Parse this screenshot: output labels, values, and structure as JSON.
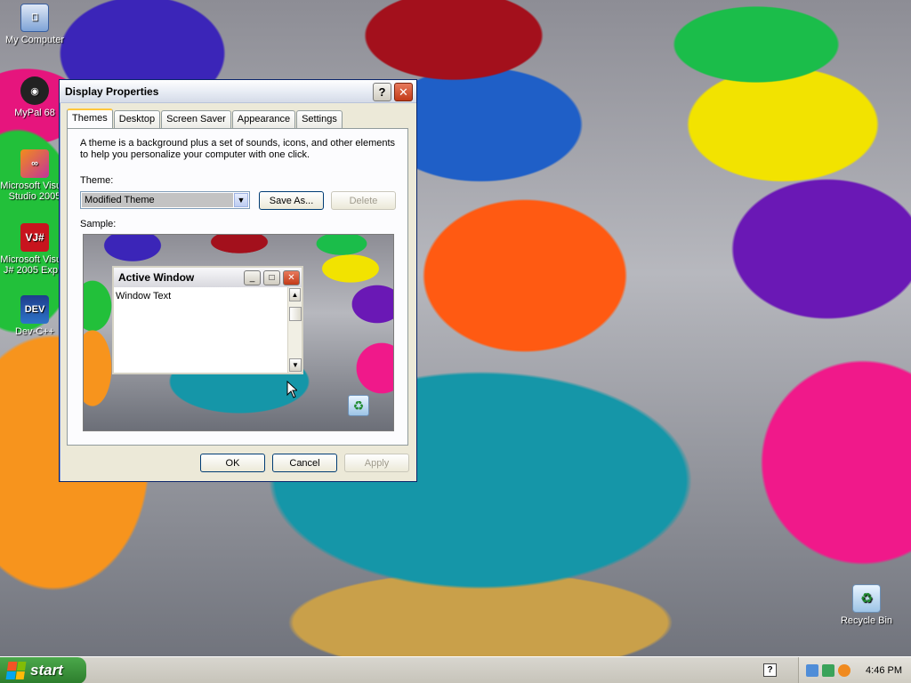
{
  "desktop_icons": [
    {
      "label": "My Computer",
      "icon": "my-computer-icon"
    },
    {
      "label": "MyPal 68",
      "icon": "mypal-icon"
    },
    {
      "label": "Microsoft Visual Studio 2005",
      "icon": "visual-studio-icon"
    },
    {
      "label": "Microsoft Visual J# 2005 Exp...",
      "icon": "vjsharp-icon"
    },
    {
      "label": "Dev-C++",
      "icon": "dev-cpp-icon"
    },
    {
      "label": "Recycle Bin",
      "icon": "recycle-bin-icon"
    }
  ],
  "window": {
    "title": "Display Properties",
    "tabs": [
      "Themes",
      "Desktop",
      "Screen Saver",
      "Appearance",
      "Settings"
    ],
    "active_tab": "Themes",
    "description": "A theme is a background plus a set of sounds, icons, and other elements to help you personalize your computer with one click.",
    "theme_label": "Theme:",
    "theme_value": "Modified Theme",
    "save_as_label": "Save As...",
    "delete_label": "Delete",
    "sample_label": "Sample:",
    "sample_window_title": "Active Window",
    "sample_window_text": "Window Text",
    "ok_label": "OK",
    "cancel_label": "Cancel",
    "apply_label": "Apply"
  },
  "taskbar": {
    "start_label": "start",
    "clock": "4:46 PM"
  }
}
